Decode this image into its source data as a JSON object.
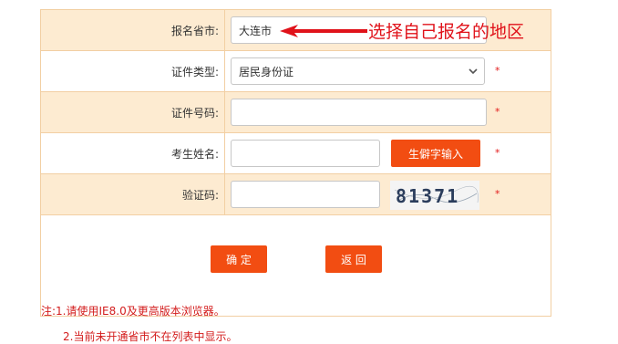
{
  "form": {
    "province_label": "报名省市:",
    "province_value": "大连市",
    "id_type_label": "证件类型:",
    "id_type_value": "居民身份证",
    "id_number_label": "证件号码:",
    "name_label": "考生姓名:",
    "rare_char_button": "生僻字输入",
    "captcha_label": "验证码:",
    "captcha_text": "81371",
    "required_mark": "*"
  },
  "actions": {
    "confirm": "确 定",
    "back": "返 回"
  },
  "notes": {
    "line1": "注:1.请使用IE8.0及更高版本浏览器。",
    "line2": "2.当前未开通省市不在列表中显示。"
  },
  "annotation": {
    "text": "选择自己报名的地区",
    "color": "#e0121a"
  },
  "colors": {
    "accent": "#f24d12",
    "row_shade": "#fdebd1",
    "border": "#f2cfa3",
    "required": "#e31c1c"
  },
  "icons": {
    "select_chevron": "chevron-down-icon",
    "annotation_arrow": "arrow-left-icon"
  }
}
